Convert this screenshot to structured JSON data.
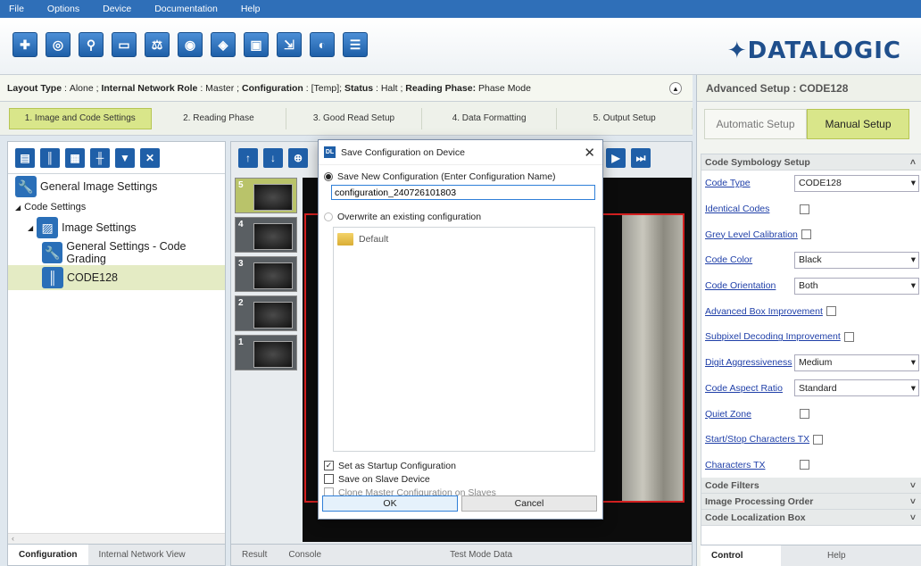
{
  "menu": [
    "File",
    "Options",
    "Device",
    "Documentation",
    "Help"
  ],
  "toolbar": {
    "tools": [
      "target-icon",
      "camera-settings-icon",
      "user-icon",
      "window-icon",
      "scale-icon",
      "camera-icon",
      "camera-config-icon",
      "monitor-icon",
      "export-icon",
      "camera-list-icon",
      "camera-edit-icon"
    ],
    "logo": "✦DATALOGIC"
  },
  "status": {
    "layout_label": "Layout Type",
    "layout_value": "Alone",
    "role_label": "Internal Network Role",
    "role_value": "Master",
    "config_label": "Configuration",
    "config_value": "[Temp]",
    "status_label": "Status",
    "status_value": "Halt",
    "phase_label": "Reading Phase:",
    "phase_value": "Phase Mode"
  },
  "phases": [
    "1. Image and Code Settings",
    "2. Reading Phase",
    "3. Good Read Setup",
    "4. Data Formatting",
    "5. Output Setup"
  ],
  "tree": {
    "items": [
      {
        "label": "General Image Settings",
        "icon": "wrench-icon"
      },
      {
        "label": "Code Settings"
      },
      {
        "label": "Image Settings",
        "icon": "image-icon"
      },
      {
        "label": "General Settings - Code Grading",
        "icon": "wrench-icon"
      },
      {
        "label": "CODE128",
        "icon": "barcode-icon"
      }
    ],
    "tabs": [
      "Configuration",
      "Internal Network View"
    ]
  },
  "center": {
    "thumbs": [
      "5",
      "4",
      "3",
      "2",
      "1"
    ],
    "tabs": [
      "Result",
      "Console",
      "Test Mode Data"
    ]
  },
  "advanced": {
    "title": "Advanced Setup : CODE128",
    "setup_tabs": [
      "Automatic Setup",
      "Manual Setup"
    ],
    "section_main": "Code Symbology Setup",
    "rows": {
      "code_type": {
        "label": "Code Type",
        "value": "CODE128"
      },
      "identical_codes": {
        "label": "Identical Codes"
      },
      "grey_level": {
        "label": "Grey Level Calibration"
      },
      "code_color": {
        "label": "Code Color",
        "value": "Black"
      },
      "code_orientation": {
        "label": "Code Orientation",
        "value": "Both"
      },
      "adv_box": {
        "label": "Advanced Box Improvement"
      },
      "subpixel": {
        "label": "Subpixel Decoding Improvement"
      },
      "digit_agg": {
        "label": "Digit Aggressiveness",
        "value": "Medium"
      },
      "aspect_ratio": {
        "label": "Code Aspect Ratio",
        "value": "Standard"
      },
      "quiet_zone": {
        "label": "Quiet Zone"
      },
      "startstop": {
        "label": "Start/Stop Characters TX"
      },
      "chars_tx": {
        "label": "Characters TX"
      }
    },
    "sections": [
      "Code Filters",
      "Image Processing Order",
      "Code Localization Box"
    ],
    "tabs": [
      "Control",
      "Help"
    ]
  },
  "dialog": {
    "title": "Save Configuration on Device",
    "new_label": "Save New Configuration (Enter Configuration Name)",
    "config_name": "configuration_240726101803",
    "overwrite_label": "Overwrite an existing configuration",
    "existing": [
      "Default"
    ],
    "startup_label": "Set as Startup Configuration",
    "slave_label": "Save on Slave Device",
    "clone_label": "Clone Master Configuration on Slaves",
    "ok_label": "OK",
    "cancel_label": "Cancel"
  }
}
